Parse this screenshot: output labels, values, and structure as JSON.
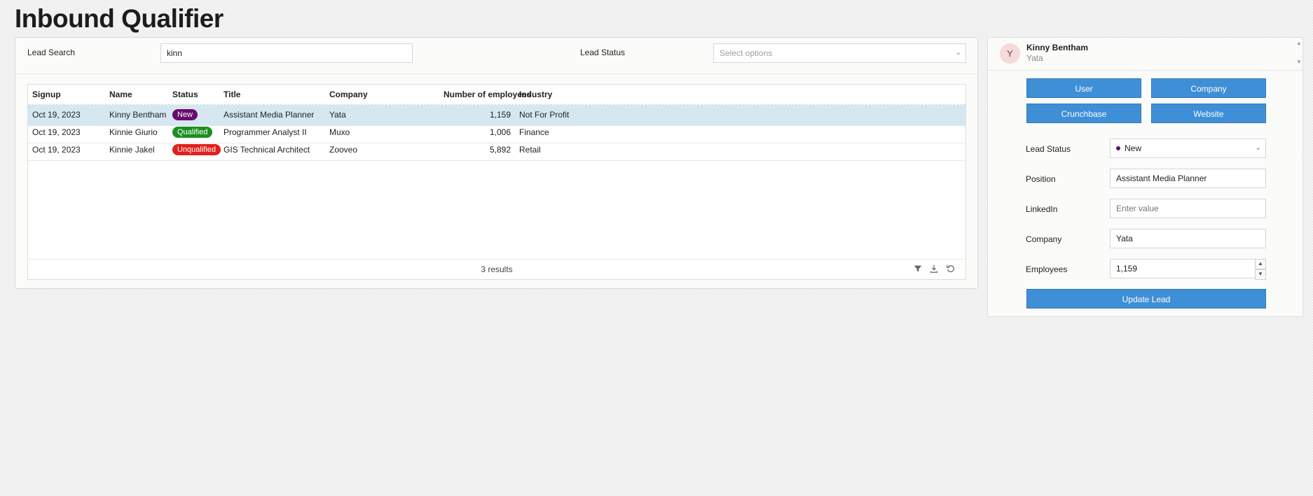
{
  "page": {
    "title": "Inbound Qualifier"
  },
  "filters": {
    "lead_search_label": "Lead Search",
    "lead_search_value": "kinn",
    "lead_status_label": "Lead Status",
    "lead_status_placeholder": "Select options"
  },
  "table": {
    "headers": [
      "Signup",
      "Name",
      "Status",
      "Title",
      "Company",
      "Number of employees",
      "Industry"
    ],
    "rows": [
      {
        "signup": "Oct 19, 2023",
        "name": "Kinny Bentham",
        "status": "New",
        "title": "Assistant Media Planner",
        "company": "Yata",
        "employees": "1,159",
        "industry": "Not For Profit",
        "selected": true
      },
      {
        "signup": "Oct 19, 2023",
        "name": "Kinnie Giurio",
        "status": "Qualified",
        "title": "Programmer Analyst II",
        "company": "Muxo",
        "employees": "1,006",
        "industry": "Finance",
        "selected": false
      },
      {
        "signup": "Oct 19, 2023",
        "name": "Kinnie Jakel",
        "status": "Unqualified",
        "title": "GIS Technical Architect",
        "company": "Zooveo",
        "employees": "5,892",
        "industry": "Retail",
        "selected": false
      }
    ],
    "footer": {
      "results": "3 results"
    },
    "status_colors": {
      "New": "#6b0a6e",
      "Qualified": "#1a9020",
      "Unqualified": "#e0201c"
    },
    "footer_icons": [
      "filter-icon",
      "download-icon",
      "refresh-icon"
    ]
  },
  "detail": {
    "avatar_initial": "Y",
    "lead_name": "Kinny Bentham",
    "lead_company": "Yata",
    "buttons": {
      "user": "User",
      "company": "Company",
      "crunchbase": "Crunchbase",
      "website": "Website",
      "update": "Update Lead"
    },
    "form": {
      "lead_status_label": "Lead Status",
      "lead_status_value": "New",
      "position_label": "Position",
      "position_value": "Assistant Media Planner",
      "linkedin_label": "LinkedIn",
      "linkedin_placeholder": "Enter value",
      "company_label": "Company",
      "company_value": "Yata",
      "employees_label": "Employees",
      "employees_value": "1,159"
    },
    "accent_color": "#3f8fd6"
  }
}
